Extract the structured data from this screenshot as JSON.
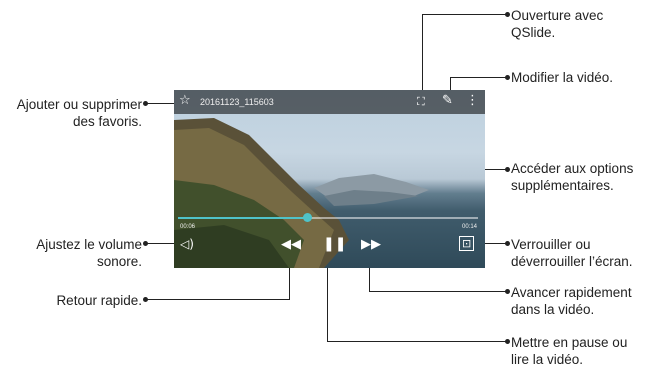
{
  "player": {
    "file_name": "20161123_115603",
    "elapsed": "00:06",
    "duration": "00:14",
    "progress": 0.43,
    "icons": {
      "favorite": "star-outline-icon",
      "qslide": "qslide-icon",
      "edit": "pencil-icon",
      "more": "more-vertical-icon",
      "volume": "volume-icon",
      "rewind": "rewind-icon",
      "pause": "pause-icon",
      "forward": "fast-forward-icon",
      "lock": "lock-icon"
    },
    "accent_color": "#4fc3c9"
  },
  "callouts": {
    "favorites": "Ajouter ou supprimer\ndes favoris.",
    "qslide": "Ouverture avec\nQSlide.",
    "edit": "Modifier la vidéo.",
    "options": "Accéder aux options\nsupplémentaires.",
    "volume": "Ajustez le volume\nsonore.",
    "lock": "Verrouiller ou\ndéverrouiller l’écran.",
    "rewind": "Retour rapide.",
    "forward": "Avancer rapidement\ndans la vidéo.",
    "pause": "Mettre en pause ou\nlire la vidéo."
  }
}
